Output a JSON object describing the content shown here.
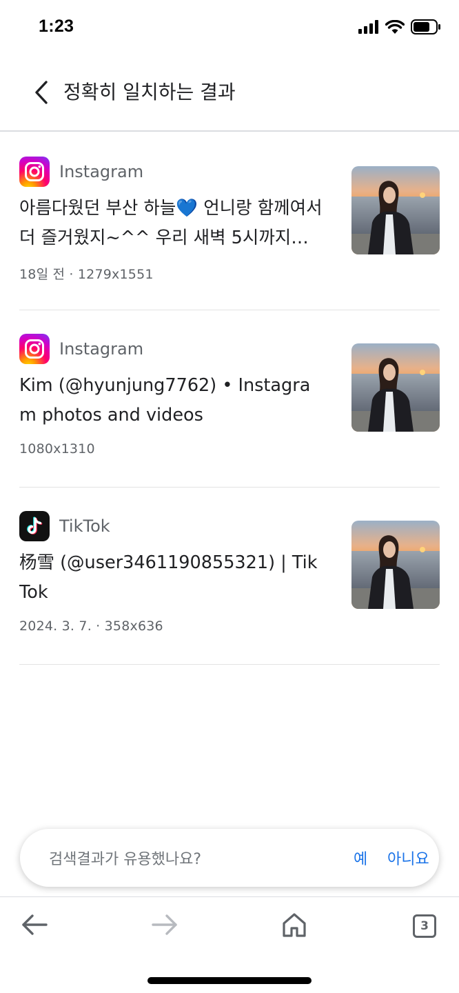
{
  "status_bar": {
    "time": "1:23",
    "icons": [
      "signal-icon",
      "wifi-icon",
      "battery-icon"
    ]
  },
  "header": {
    "title": "정확히 일치하는 결과",
    "back_icon": "chevron-left-icon"
  },
  "results": [
    {
      "source": "Instagram",
      "logo": "instagram-logo",
      "title": "아름다웠던 부산 하늘💙 언니랑 함께여서 더 즐거웠지~^^ 우리 새벽 5시까지…",
      "meta": "18일 전 · 1279x1551"
    },
    {
      "source": "Instagram",
      "logo": "instagram-logo",
      "title": "Kim (@hyunjung7762) • Instagram photos and videos",
      "meta": "1080x1310"
    },
    {
      "source": "TikTok",
      "logo": "tiktok-logo",
      "title": "杨雪 (@user3461190855321) | TikTok",
      "meta": "2024. 3. 7. · 358x636"
    }
  ],
  "feedback": {
    "question": "검색결과가 유용했나요?",
    "yes": "예",
    "no": "아니요"
  },
  "toolbar": {
    "back_icon": "arrow-left-icon",
    "forward_icon": "arrow-right-icon",
    "home_icon": "home-icon",
    "tab_count": "3"
  },
  "colors": {
    "link": "#1a73e8",
    "secondary_text": "#5f6368",
    "divider": "#e3e3e3"
  }
}
